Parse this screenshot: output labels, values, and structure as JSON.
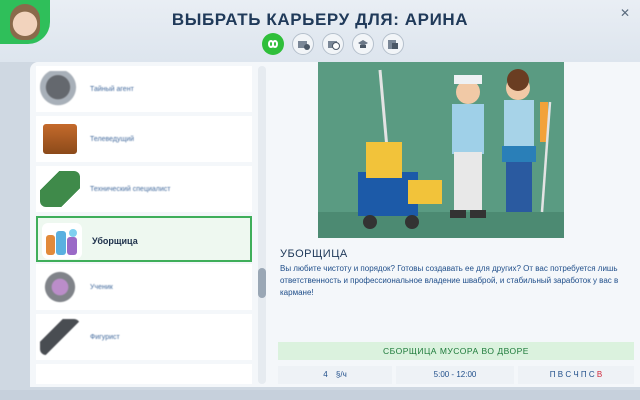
{
  "header": {
    "title": "ВЫБРАТЬ КАРЬЕРУ ДЛЯ: АРИНА",
    "close_symbol": "✕"
  },
  "filters": [
    {
      "name": "infinity-icon",
      "active": true
    },
    {
      "name": "work-from-home-icon",
      "active": false
    },
    {
      "name": "part-time-icon",
      "active": false
    },
    {
      "name": "student-icon",
      "active": false
    },
    {
      "name": "odd-job-icon",
      "active": false
    }
  ],
  "careers": [
    {
      "label": "Тайный агент",
      "icon": "secret-agent-icon"
    },
    {
      "label": "Телеведущий",
      "icon": "tv-icon"
    },
    {
      "label": "Технический специалист",
      "icon": "circuit-board-icon"
    },
    {
      "label": "Уборщица",
      "icon": "cleaning-supplies-icon",
      "selected": true
    },
    {
      "label": "Ученик",
      "icon": "student-icon"
    },
    {
      "label": "Фигурист",
      "icon": "figure-skate-icon"
    }
  ],
  "detail": {
    "name": "УБОРЩИЦА",
    "description": "Вы любите чистоту и порядок? Готовы создавать ее для других? От вас потребуется лишь ответственность и профессиональное владение шваброй, и стабильный заработок у вас в кармане!",
    "job_title": "СБОРЩИЦА МУСОРА ВО ДВОРЕ",
    "pay": "4",
    "pay_unit": "§/ч",
    "hours": "5:00 - 12:00",
    "workdays": "П В С Ч П С",
    "day_off": "В"
  },
  "colors": {
    "accent": "#2fbf3a",
    "selected_border": "#3fae5a",
    "text_blue": "#1f4e8a",
    "illustration_bg": "#5a9b82",
    "day_off": "#d0283c"
  }
}
